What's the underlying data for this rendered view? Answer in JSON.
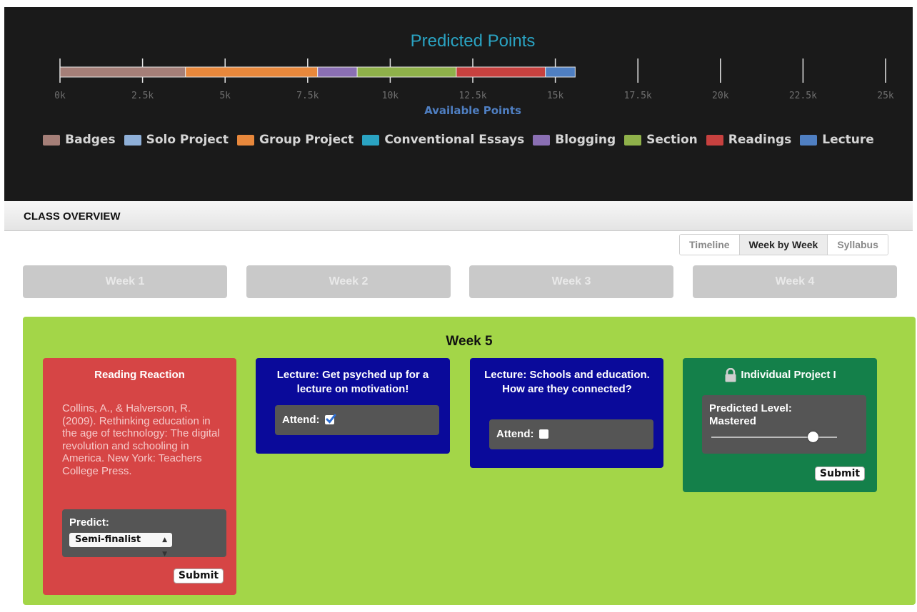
{
  "chart_data": {
    "type": "bar",
    "orientation": "horizontal-stacked",
    "title": "Predicted Points",
    "xlabel": "Available Points",
    "xlim": [
      0,
      25000
    ],
    "xticks": [
      "0k",
      "2.5k",
      "5k",
      "7.5k",
      "10k",
      "12.5k",
      "15k",
      "17.5k",
      "20k",
      "22.5k",
      "25k"
    ],
    "legend_position": "bottom",
    "series": [
      {
        "name": "Badges",
        "value": 3800,
        "color": "#a57f78"
      },
      {
        "name": "Solo Project",
        "value": 0,
        "color": "#8fb0d8"
      },
      {
        "name": "Group Project",
        "value": 4000,
        "color": "#e8883c"
      },
      {
        "name": "Conventional Essays",
        "value": 0,
        "color": "#2aa3c2"
      },
      {
        "name": "Blogging",
        "value": 1200,
        "color": "#8a6fb3"
      },
      {
        "name": "Section",
        "value": 3000,
        "color": "#8fb14a"
      },
      {
        "name": "Readings",
        "value": 2700,
        "color": "#c7413f"
      },
      {
        "name": "Lecture",
        "value": 900,
        "color": "#4f7fc2"
      }
    ],
    "title_color": "#2aa3c2",
    "xlabel_color": "#4f7fc2"
  },
  "overview": {
    "title": "CLASS OVERVIEW"
  },
  "view_tabs": [
    {
      "label": "Timeline",
      "active": false
    },
    {
      "label": "Week by Week",
      "active": true
    },
    {
      "label": "Syllabus",
      "active": false
    }
  ],
  "weeks": [
    "Week 1",
    "Week 2",
    "Week 3",
    "Week 4"
  ],
  "week_panel": {
    "title": "Week 5",
    "reading": {
      "title": "Reading Reaction",
      "citation": "Collins, A., & Halverson, R. (2009). Rethinking education in the age of technology: The digital revolution and schooling in America. New York: Teachers College Press.",
      "predict_label": "Predict:",
      "predict_value": "Semi-finalist",
      "submit_label": "Submit"
    },
    "lecture1": {
      "title": "Lecture: Get psyched up for a lecture on motivation!",
      "attend_label": "Attend:",
      "attended": true
    },
    "lecture2": {
      "title": "Lecture: Schools and education. How are they connected?",
      "attend_label": "Attend:",
      "attended": false
    },
    "project": {
      "title": "Individual Project I",
      "icon": "lock-icon",
      "level_label": "Predicted Level: Mastered",
      "slider_fraction": 0.81,
      "submit_label": "Submit"
    }
  }
}
